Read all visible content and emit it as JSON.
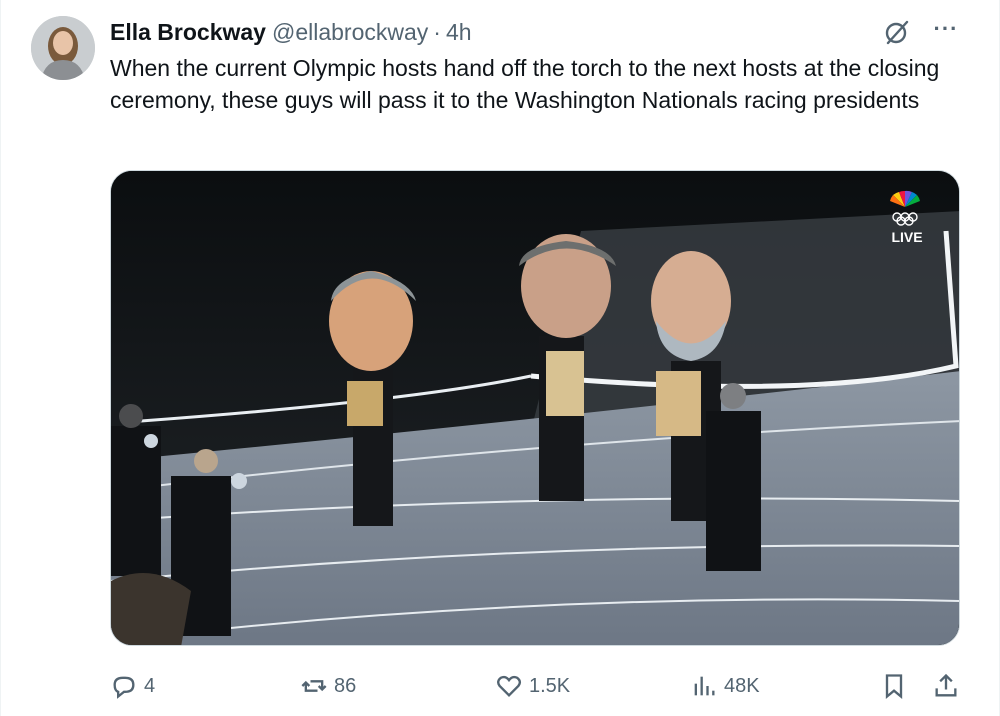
{
  "tweet": {
    "author_name": "Ella Brockway",
    "handle": "@ellabrockway",
    "separator": "·",
    "time": "4h",
    "more_label": "···",
    "text": "When the current Olympic hosts hand off the torch to the next hosts at the closing ceremony, these guys will pass it to the Washington Nationals racing presidents"
  },
  "media": {
    "broadcast_badge": "LIVE"
  },
  "actions": {
    "replies": "4",
    "reposts": "86",
    "likes": "1.5K",
    "views": "48K"
  },
  "icons": [
    "grok-icon",
    "more-icon",
    "reply-icon",
    "repost-icon",
    "like-icon",
    "views-icon",
    "bookmark-icon",
    "share-icon"
  ],
  "colors": {
    "text": "#0f1419",
    "secondary": "#536471",
    "border": "#cfd9de"
  }
}
